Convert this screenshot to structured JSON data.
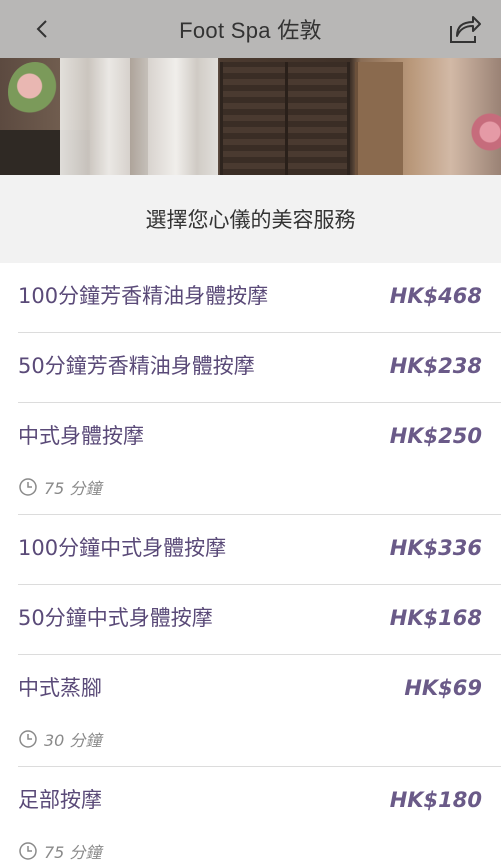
{
  "header": {
    "title": "Foot Spa 佐敦",
    "back_icon": "chevron-left-icon",
    "share_icon": "share-icon"
  },
  "section": {
    "title": "選擇您心儀的美容服務"
  },
  "colors": {
    "name_text": "#5a4a78",
    "price_text": "#6a5a88",
    "section_bg": "#f2f2f2"
  },
  "services": [
    {
      "name": "100分鐘芳香精油身體按摩",
      "price": "HK$468",
      "duration": ""
    },
    {
      "name": "50分鐘芳香精油身體按摩",
      "price": "HK$238",
      "duration": ""
    },
    {
      "name": "中式身體按摩",
      "price": "HK$250",
      "duration": "75 分鐘"
    },
    {
      "name": "100分鐘中式身體按摩",
      "price": "HK$336",
      "duration": ""
    },
    {
      "name": "50分鐘中式身體按摩",
      "price": "HK$168",
      "duration": ""
    },
    {
      "name": "中式蒸腳",
      "price": "HK$69",
      "duration": "30 分鐘"
    },
    {
      "name": "足部按摩",
      "price": "HK$180",
      "duration": "75 分鐘"
    }
  ]
}
